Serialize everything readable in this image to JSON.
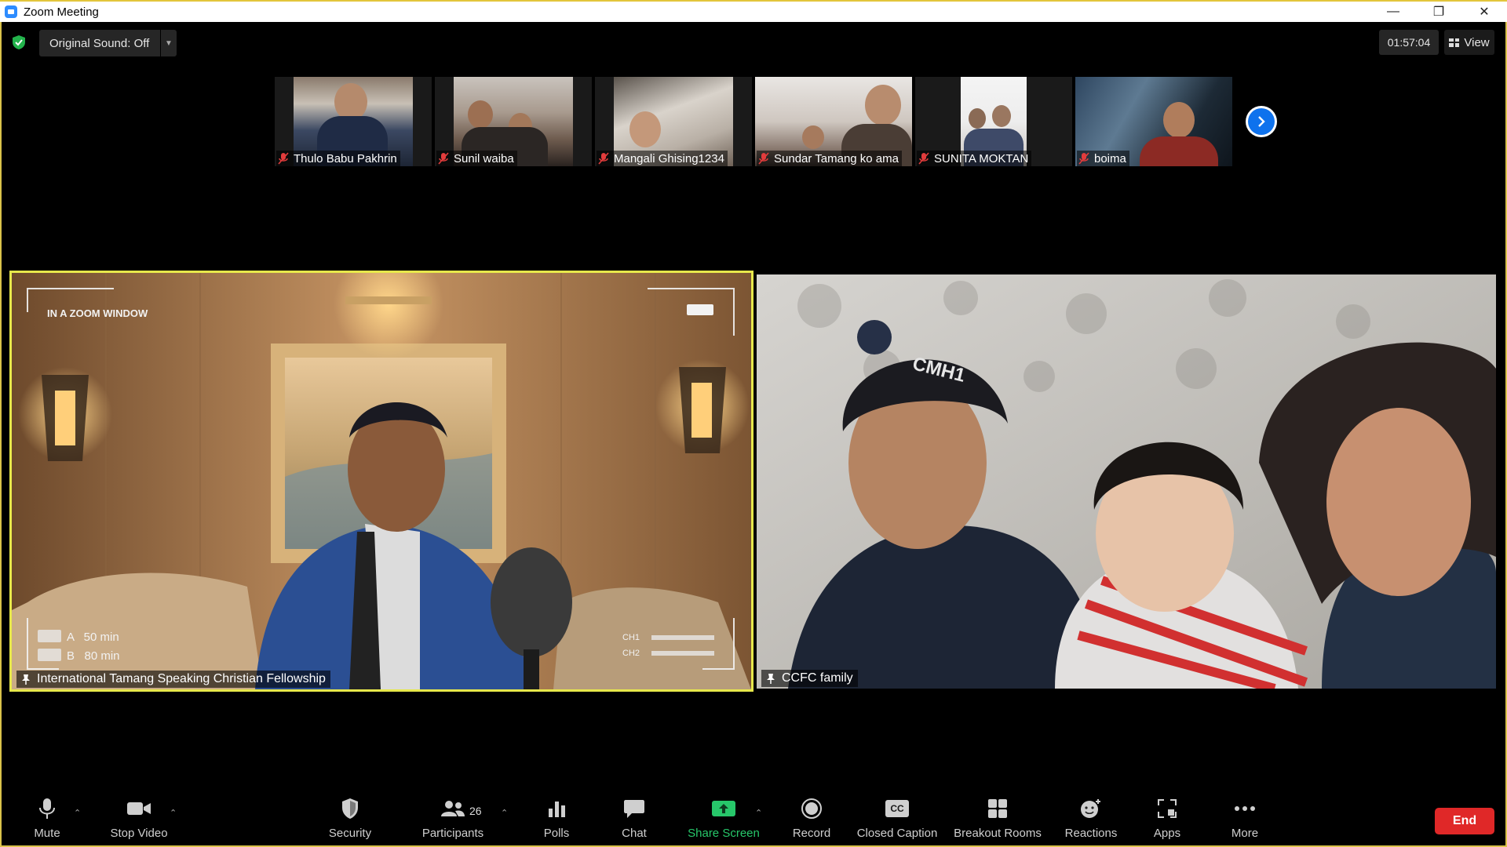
{
  "window": {
    "title": "Zoom Meeting"
  },
  "topbar": {
    "original_sound": "Original Sound: Off",
    "timer": "01:57:04",
    "view_label": "View"
  },
  "thumbnails": [
    {
      "name": "Thulo Babu Pakhrin",
      "muted": true
    },
    {
      "name": "Sunil waiba",
      "muted": true
    },
    {
      "name": "Mangali  Ghising1234",
      "muted": true
    },
    {
      "name": "Sundar Tamang ko ama",
      "muted": true
    },
    {
      "name": "SUNITA  MOKTAN",
      "muted": true
    },
    {
      "name": "boima",
      "muted": true
    }
  ],
  "main": {
    "left": {
      "name": "International Tamang Speaking Christian Fellowship",
      "overlay_title": "IN A ZOOM WINDOW",
      "overlay_a": "A   50 min",
      "overlay_b": "B   80 min",
      "ch1": "CH1",
      "ch2": "CH2"
    },
    "right": {
      "name": "CCFC family",
      "hat_text": "CMH1"
    }
  },
  "toolbar": {
    "mute": "Mute",
    "stop_video": "Stop Video",
    "security": "Security",
    "participants": "Participants",
    "participant_count": "26",
    "polls": "Polls",
    "chat": "Chat",
    "share_screen": "Share Screen",
    "record": "Record",
    "closed_caption": "Closed Caption",
    "cc_badge": "CC",
    "breakout_rooms": "Breakout Rooms",
    "reactions": "Reactions",
    "apps": "Apps",
    "more": "More",
    "end": "End"
  },
  "colors": {
    "active_speaker_border": "#e7e84b",
    "share_green": "#27c76a",
    "end_red": "#e02828",
    "accent_blue": "#0e72ed"
  }
}
